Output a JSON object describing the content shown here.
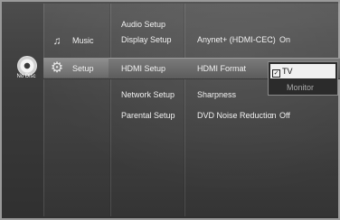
{
  "disc": {
    "icon": "no-disc-icon",
    "label": "No Disc"
  },
  "main_menu": [
    {
      "label": "Music",
      "icon": "music-note-icon"
    },
    {
      "label": "Setup",
      "icon": "gear-icon"
    }
  ],
  "sub_menu": [
    "Audio Setup",
    "Display Setup",
    "HDMI Setup",
    "Network Setup",
    "Parental Setup"
  ],
  "settings": [
    {
      "label": "Anynet+ (HDMI-CEC)",
      "sep": ":",
      "value": "On"
    },
    {
      "label": "HDMI Format",
      "sep": "",
      "value": ""
    },
    {
      "label": "Sharpness",
      "sep": "",
      "value": ""
    },
    {
      "label": "DVD Noise Reduction",
      "sep": ":",
      "value": "Off"
    }
  ],
  "dropdown": {
    "selected": "TV",
    "options": [
      "Monitor"
    ]
  },
  "colors": {
    "highlight": "#6e6e6e",
    "selected_option_bg": "#f0f0f0"
  }
}
